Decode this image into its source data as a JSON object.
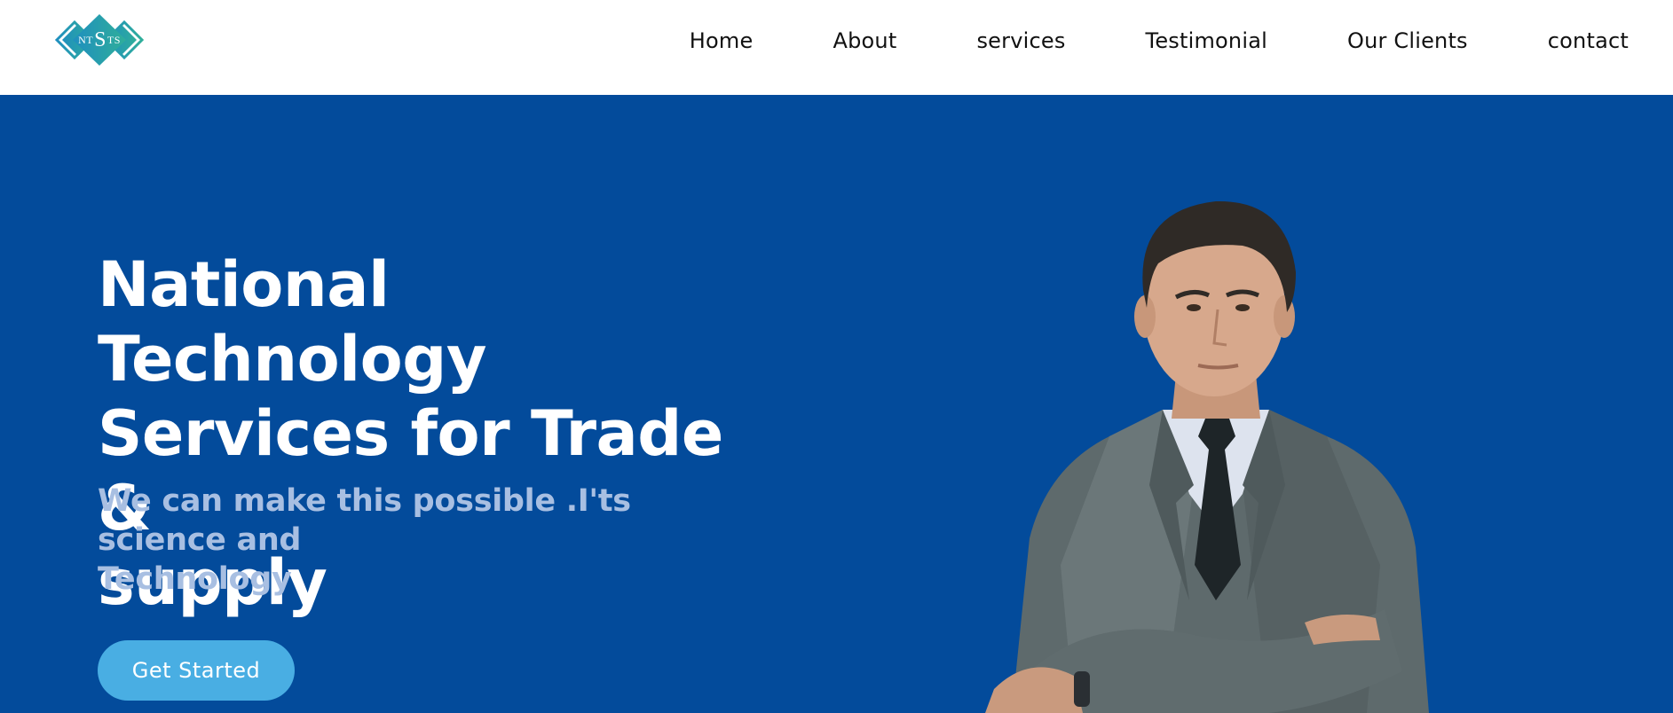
{
  "header": {
    "logo": {
      "text_left": "NT",
      "text_center": "S",
      "text_right": "TS",
      "colors": [
        "#1f8fbf",
        "#2fae9a"
      ]
    },
    "nav": [
      {
        "label": "Home"
      },
      {
        "label": "About"
      },
      {
        "label": "services"
      },
      {
        "label": "Testimonial"
      },
      {
        "label": "Our Clients"
      },
      {
        "label": "contact"
      }
    ]
  },
  "hero": {
    "title_lines": [
      "National Technology",
      "Services for Trade &",
      "supply"
    ],
    "subtitle_lines": [
      "We can make this possible .I'ts science and",
      "Technology"
    ],
    "cta_label": "Get Started",
    "background_color": "#034b9b",
    "cta_color": "#49aee3",
    "image_alt": "businessman-portrait"
  }
}
